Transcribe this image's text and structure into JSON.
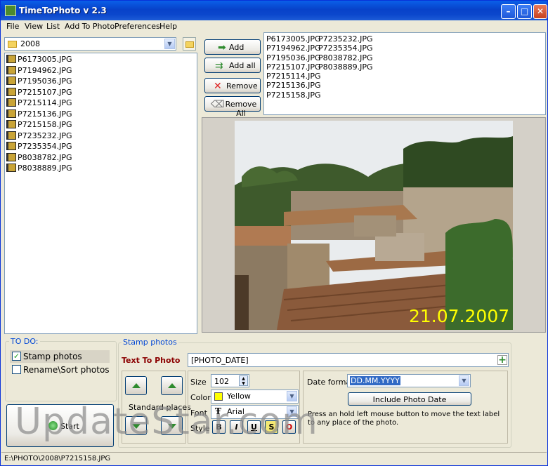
{
  "window": {
    "title": "TimeToPhoto v 2.3",
    "controls": {
      "minimize": "–",
      "maximize": "□",
      "close": "✕"
    }
  },
  "menu": [
    "File",
    "View",
    "List",
    "Add To Photo",
    "Preferences",
    "Help"
  ],
  "folder": {
    "current": "2008",
    "icon": "folder-icon"
  },
  "files": [
    "P6173005.JPG",
    "P7194962.JPG",
    "P7195036.JPG",
    "P7215107.JPG",
    "P7215114.JPG",
    "P7215136.JPG",
    "P7215158.JPG",
    "P7235232.JPG",
    "P7235354.JPG",
    "P8038782.JPG",
    "P8038889.JPG"
  ],
  "buttons": {
    "add": "Add",
    "add_all": "Add all",
    "remove": "Remove",
    "remove_all": "Remove All"
  },
  "selected_files": {
    "col1": [
      "P6173005.JPG",
      "P7194962.JPG",
      "P7195036.JPG",
      "P7215107.JPG",
      "P7215114.JPG",
      "P7215136.JPG",
      "P7215158.JPG"
    ],
    "col2": [
      "P7235232.JPG",
      "P7235354.JPG",
      "P8038782.JPG",
      "P8038889.JPG"
    ]
  },
  "preview": {
    "date_stamp": "21.07.2007",
    "stamp_color": "#FFFF00"
  },
  "todo": {
    "legend": "TO DO:",
    "stamp_photos": "Stamp photos",
    "rename_sort": "Rename\\Sort photos",
    "stamp_checked": "✓",
    "start": "Start"
  },
  "stamp": {
    "legend": "Stamp photos",
    "text_label": "Text To Photo",
    "text_value": "[PHOTO_DATE]",
    "standard_places": "Standard places",
    "size_label": "Size",
    "size_value": "102",
    "color_label": "Color",
    "color_value": "Yellow",
    "color_swatch": "#FFFF00",
    "font_label": "Font",
    "font_value": "Arial",
    "style_label": "Style",
    "styles": [
      "B",
      "I",
      "U",
      "S",
      "O"
    ],
    "date_format_label": "Date format",
    "date_format_value": "DD.MM.YYYY",
    "include_date": "Include Photo Date",
    "hint": "Press an hold left mouse button to move the text label to any place of the photo."
  },
  "status": "E:\\PHOTO\\2008\\P7215158.JPG",
  "watermark": "UpdateStar.com"
}
